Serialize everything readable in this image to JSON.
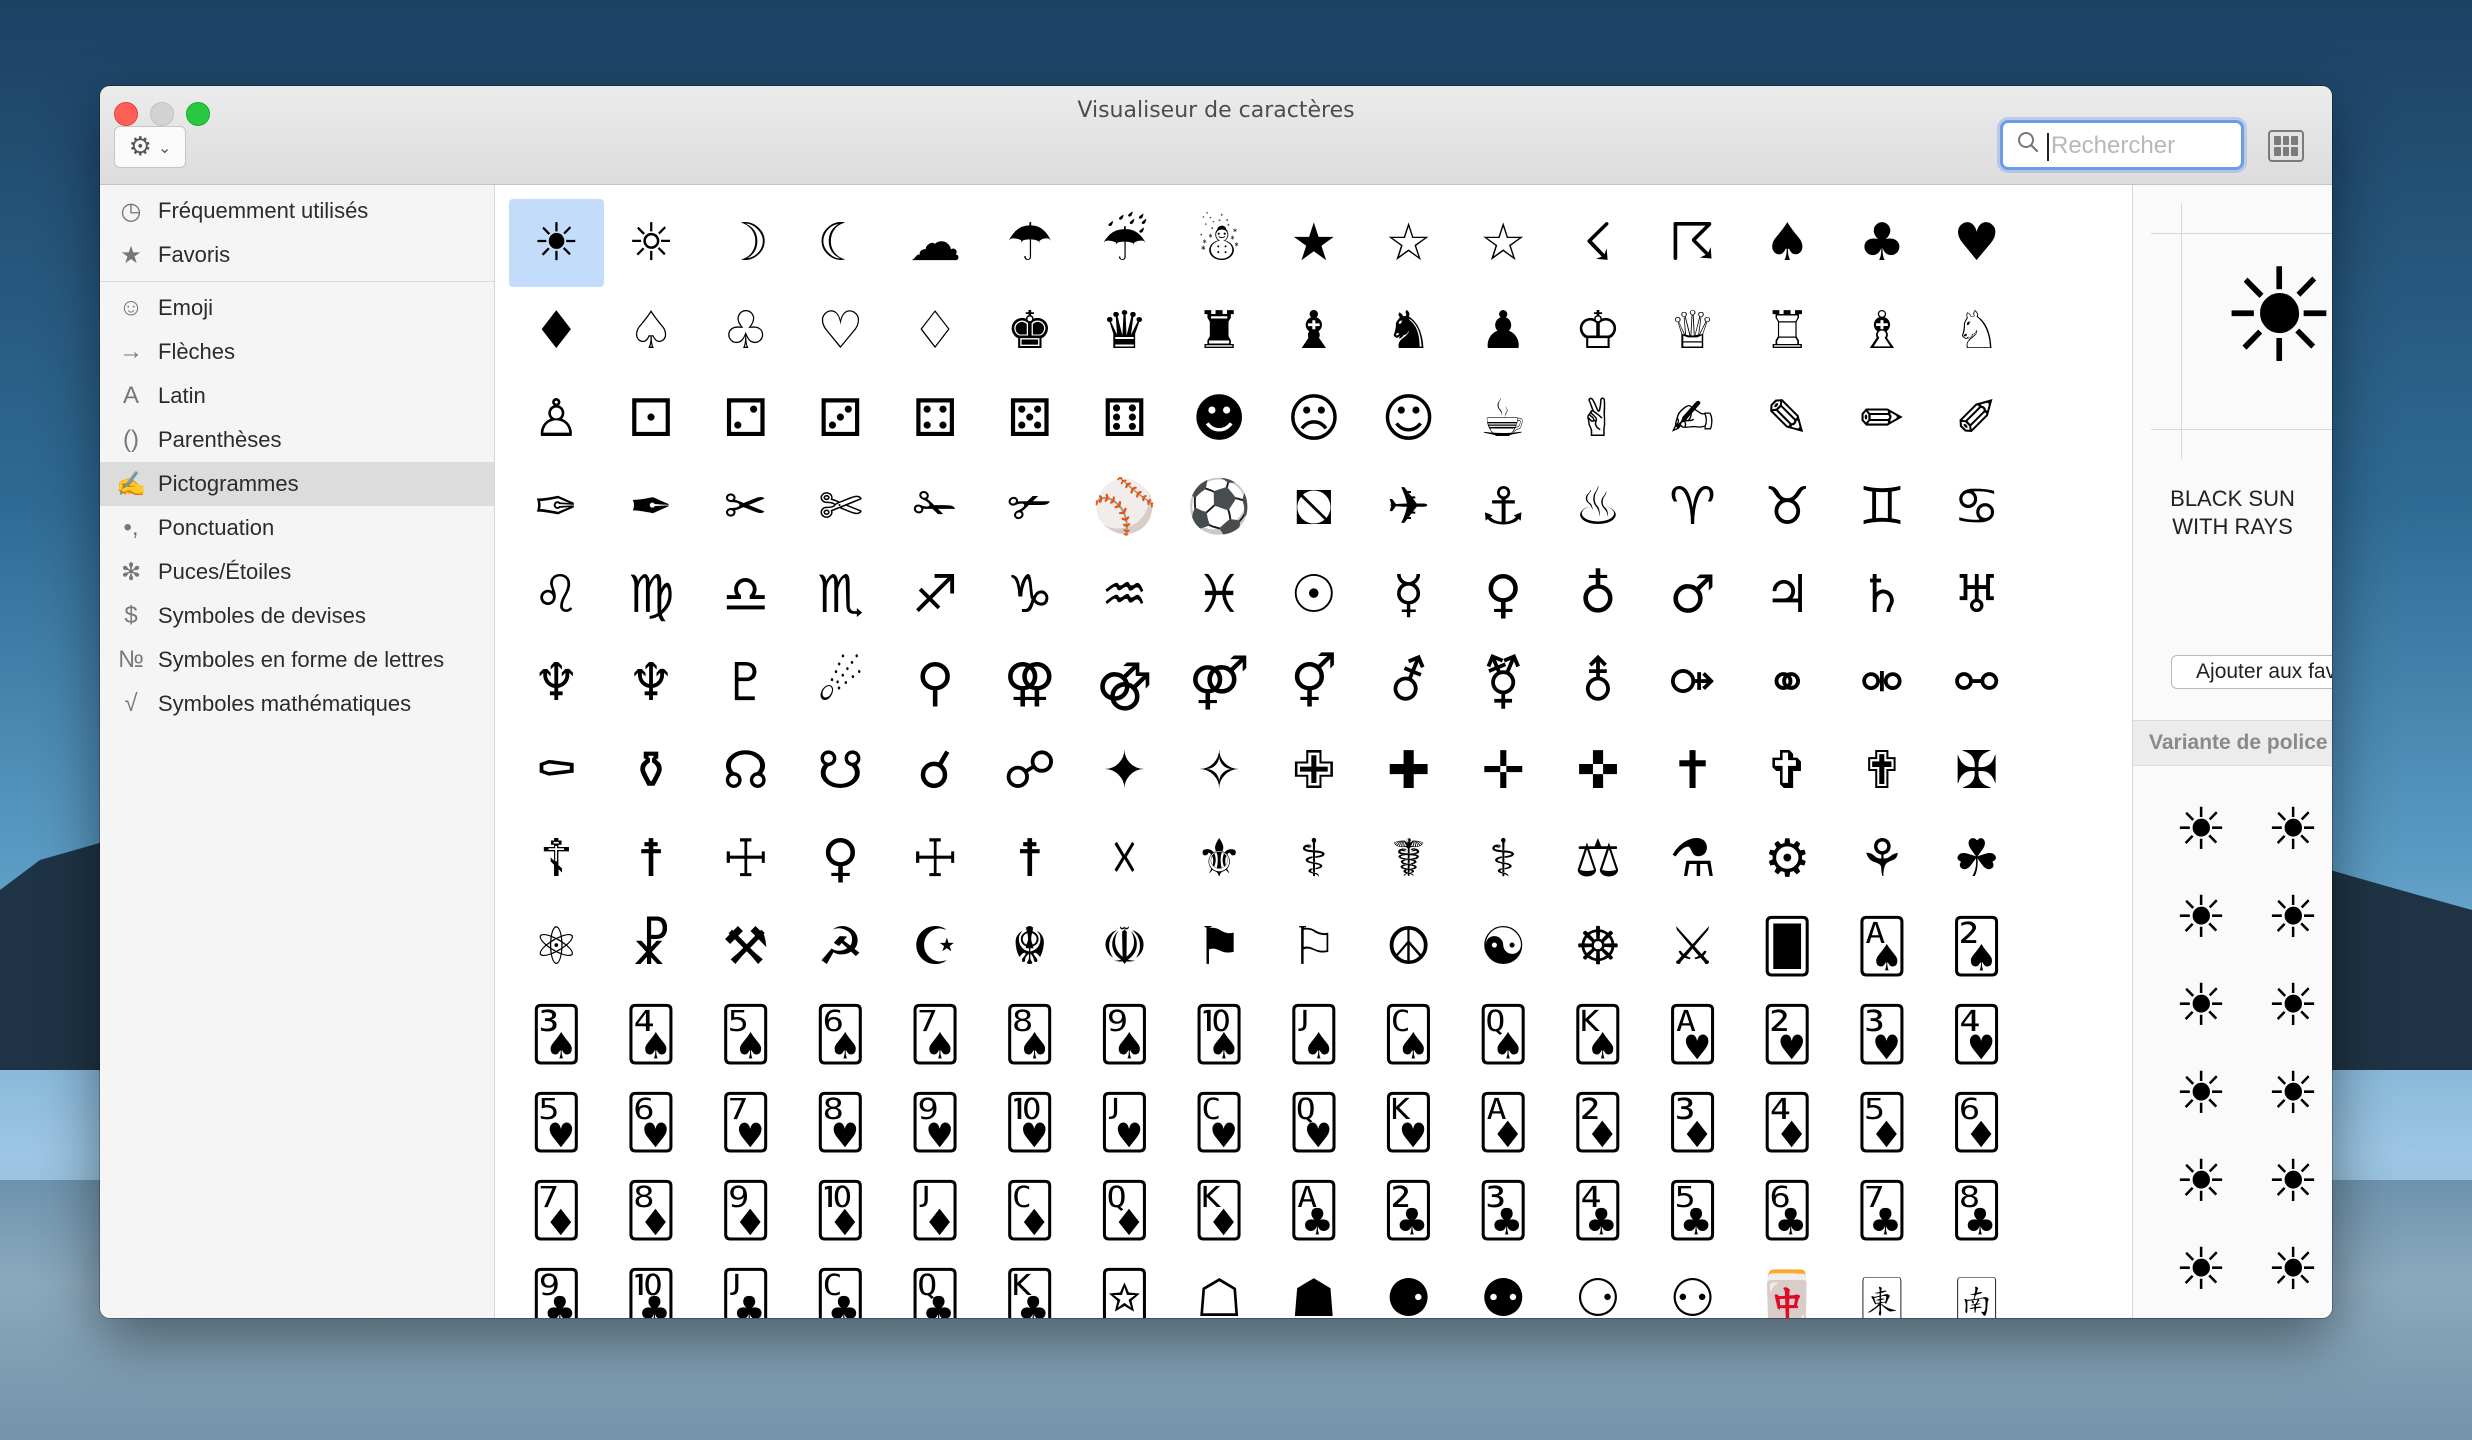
{
  "window": {
    "title": "Visualiseur de caractères"
  },
  "toolbar": {
    "gear_icon": "⚙",
    "chevron": "⌄",
    "search_placeholder": "Rechercher"
  },
  "sidebar": {
    "items": [
      {
        "label": "Fréquemment utilisés",
        "icon": "◷"
      },
      {
        "label": "Favoris",
        "icon": "★"
      },
      {
        "label": "Emoji",
        "icon": "☺"
      },
      {
        "label": "Flèches",
        "icon": "→"
      },
      {
        "label": "Latin",
        "icon": "A"
      },
      {
        "label": "Parenthèses",
        "icon": "()"
      },
      {
        "label": "Pictogrammes",
        "icon": "✍",
        "active": true
      },
      {
        "label": "Ponctuation",
        "icon": "•,"
      },
      {
        "label": "Puces/Étoiles",
        "icon": "✻"
      },
      {
        "label": "Symboles de devises",
        "icon": "$"
      },
      {
        "label": "Symboles en forme de lettres",
        "icon": "№"
      },
      {
        "label": "Symboles mathématiques",
        "icon": "√"
      }
    ]
  },
  "grid": {
    "selected_index": 0,
    "rows": [
      [
        "☀",
        "☼",
        "☽",
        "☾",
        "☁",
        "☂",
        "☔",
        "☃",
        "★",
        "☆",
        "☆",
        "☇",
        "☈",
        "♠",
        "♣",
        "♥"
      ],
      [
        "♦",
        "♤",
        "♧",
        "♡",
        "♢",
        "♚",
        "♛",
        "♜",
        "♝",
        "♞",
        "♟",
        "♔",
        "♕",
        "♖",
        "♗",
        "♘"
      ],
      [
        "♙",
        "⚀",
        "⚁",
        "⚂",
        "⚃",
        "⚄",
        "⚅",
        "☻",
        "☹",
        "☺",
        "☕",
        "✌",
        "✍",
        "✎",
        "✏",
        "✐"
      ],
      [
        "✑",
        "✒",
        "✂",
        "✄",
        "✁",
        "✃",
        "⚾",
        "⚽",
        "⛞",
        "✈",
        "⚓",
        "♨",
        "♈",
        "♉",
        "♊",
        "♋"
      ],
      [
        "♌",
        "♍",
        "♎",
        "♏",
        "♐",
        "♑",
        "♒",
        "♓",
        "☉",
        "☿",
        "♀",
        "♁",
        "♂",
        "♃",
        "♄",
        "♅"
      ],
      [
        "♆",
        "♆",
        "♇",
        "☄",
        "⚲",
        "⚢",
        "⚣",
        "⚤",
        "⚥",
        "⚦",
        "⚧",
        "⚨",
        "⚩",
        "⚭",
        "⚮",
        "⚯"
      ],
      [
        "⚰",
        "⚱",
        "☊",
        "☋",
        "☌",
        "☍",
        "✦",
        "✧",
        "✙",
        "✚",
        "✛",
        "✜",
        "✝",
        "✞",
        "✟",
        "✠"
      ],
      [
        "☦",
        "☨",
        "☩",
        "♀",
        "☩",
        "☨",
        "☓",
        "⚜",
        "⚕",
        "☤",
        "⚕",
        "⚖",
        "⚗",
        "⚙",
        "⚘",
        "☘"
      ],
      [
        "⚛",
        "☧",
        "⚒",
        "☭",
        "☪",
        "☬",
        "☫",
        "⚑",
        "⚐",
        "☮",
        "☯",
        "☸",
        "⚔",
        "🂠",
        "🂡",
        "🂢"
      ],
      [
        "🂣",
        "🂤",
        "🂥",
        "🂦",
        "🂧",
        "🂨",
        "🂩",
        "🂪",
        "🂫",
        "🂬",
        "🂭",
        "🂮",
        "🂱",
        "🂲",
        "🂳",
        "🂴"
      ],
      [
        "🂵",
        "🂶",
        "🂷",
        "🂸",
        "🂹",
        "🂺",
        "🂻",
        "🂼",
        "🂽",
        "🂾",
        "🃁",
        "🃂",
        "🃃",
        "🃄",
        "🃅",
        "🃆"
      ],
      [
        "🃇",
        "🃈",
        "🃉",
        "🃊",
        "🃋",
        "🃌",
        "🃍",
        "🃎",
        "🃑",
        "🃒",
        "🃓",
        "🃔",
        "🃕",
        "🃖",
        "🃗",
        "🃘"
      ],
      [
        "🃙",
        "🃚",
        "🃛",
        "🃜",
        "🃝",
        "🃞",
        "🃟",
        "☖",
        "☗",
        "⚈",
        "⚉",
        "⚆",
        "⚇",
        "🀄",
        "🀀",
        "🀁"
      ]
    ]
  },
  "inspector": {
    "preview_glyph": "☀",
    "char_name": "BLACK SUN\nWITH RAYS",
    "add_favorite_label": "Ajouter aux favoris",
    "variant_header": "Variante de police",
    "variants": [
      "☀",
      "☀",
      "☀",
      "☀",
      "☀",
      "☀",
      "☀",
      "☀",
      "☀",
      "☀",
      "☀",
      "☀",
      "☀",
      "☀",
      "☀",
      "☀",
      "☀",
      "☀",
      "☀",
      "☀",
      "☀"
    ]
  }
}
